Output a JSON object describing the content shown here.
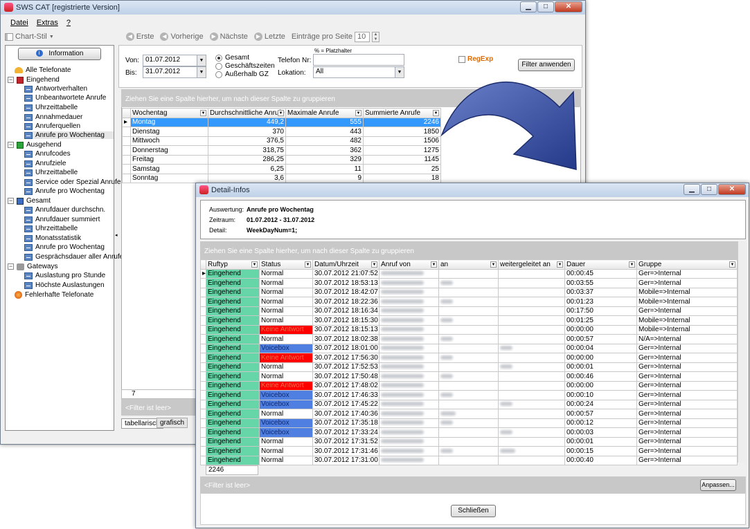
{
  "main_window": {
    "title": "SWS CAT [registrierte Version]",
    "menu": [
      "Datei",
      "Extras",
      "?"
    ],
    "toolbar": {
      "chart_style": "Chart-Stil",
      "first": "Erste",
      "prev": "Vorherige",
      "next": "Nächste",
      "last": "Letzte",
      "per_page_label": "Einträge pro Seite",
      "per_page_value": "10"
    },
    "sidebar": {
      "info_button": "Information",
      "items": [
        {
          "label": "Alle Telefonate"
        },
        {
          "label": "Eingehend"
        },
        {
          "label": "Antwortverhalten"
        },
        {
          "label": "Unbeantwortete Anrufe"
        },
        {
          "label": "Uhrzeittabelle"
        },
        {
          "label": "Annahmedauer"
        },
        {
          "label": "Anruferquellen"
        },
        {
          "label": "Anrufe pro Wochentag"
        },
        {
          "label": "Ausgehend"
        },
        {
          "label": "Anrufcodes"
        },
        {
          "label": "Anrufziele"
        },
        {
          "label": "Uhrzeittabelle"
        },
        {
          "label": "Service oder Spezial Anrufe"
        },
        {
          "label": "Anrufe pro Wochentag"
        },
        {
          "label": "Gesamt"
        },
        {
          "label": "Anrufdauer durchschn."
        },
        {
          "label": "Anrufdauer summiert"
        },
        {
          "label": "Uhrzeittabelle"
        },
        {
          "label": "Monatsstatistik"
        },
        {
          "label": "Anrufe pro Wochentag"
        },
        {
          "label": "Gesprächsdauer aller Anrufe"
        },
        {
          "label": "Gateways"
        },
        {
          "label": "Auslastung pro Stunde"
        },
        {
          "label": "Höchste Auslastungen"
        },
        {
          "label": "Fehlerhafte Telefonate"
        }
      ]
    },
    "filter": {
      "von_label": "Von:",
      "von_value": "01.07.2012",
      "bis_label": "Bis:",
      "bis_value": "31.07.2012",
      "radio_gesamt": "Gesamt",
      "radio_geschaeft": "Geschäftszeiten",
      "radio_ausserhalb": "Außerhalb GZ",
      "placeholder_hint": "% = Platzhalter",
      "telefon_label": "Telefon Nr:",
      "lokation_label": "Lokation:",
      "lokation_value": "All",
      "regexp_label": "RegExp",
      "apply_button": "Filter anwenden"
    },
    "group_hint": "Ziehen Sie eine Spalte hierher, um nach dieser Spalte zu gruppieren",
    "grid": {
      "headers": [
        "Wochentag",
        "Durchschnittliche Anrufe",
        "Maximale Anrufe",
        "Summierte Anrufe"
      ],
      "rows": [
        [
          "Montag",
          "449,2",
          "555",
          "2246"
        ],
        [
          "Dienstag",
          "370",
          "443",
          "1850"
        ],
        [
          "Mittwoch",
          "376,5",
          "482",
          "1506"
        ],
        [
          "Donnerstag",
          "318,75",
          "362",
          "1275"
        ],
        [
          "Freitag",
          "286,25",
          "329",
          "1145"
        ],
        [
          "Samstag",
          "6,25",
          "11",
          "25"
        ],
        [
          "Sonntag",
          "3,6",
          "9",
          "18"
        ]
      ],
      "footer_count": "7",
      "filter_empty": "<Filter ist leer>"
    },
    "tabs": [
      "tabellarisch",
      "grafisch"
    ]
  },
  "detail_window": {
    "title": "Detail-Infos",
    "auswertung_label": "Auswertung:",
    "auswertung_value": "Anrufe pro Wochentag",
    "zeitraum_label": "Zeitraum:",
    "zeitraum_value": "01.07.2012 - 31.07.2012",
    "detail_label": "Detail:",
    "detail_value": "WeekDayNum=1;",
    "group_hint": "Ziehen Sie eine Spalte hierher, um nach dieser Spalte zu gruppieren",
    "headers": [
      "Ruftyp",
      "Status",
      "Datum/Uhrzeit",
      "Anruf von",
      "an",
      "weitergeleitet an",
      "Dauer",
      "Gruppe"
    ],
    "rows": [
      {
        "typ": "Eingehend",
        "status": "Normal",
        "datum": "30.07.2012 21:07:52",
        "dauer": "00:00:45",
        "gruppe": "Ger=>Internal"
      },
      {
        "typ": "Eingehend",
        "status": "Normal",
        "datum": "30.07.2012 18:53:13",
        "dauer": "00:03:55",
        "gruppe": "Ger=>Internal"
      },
      {
        "typ": "Eingehend",
        "status": "Normal",
        "datum": "30.07.2012 18:42:07",
        "dauer": "00:03:37",
        "gruppe": "Mobile=>Internal"
      },
      {
        "typ": "Eingehend",
        "status": "Normal",
        "datum": "30.07.2012 18:22:36",
        "dauer": "00:01:23",
        "gruppe": "Mobile=>Internal"
      },
      {
        "typ": "Eingehend",
        "status": "Normal",
        "datum": "30.07.2012 18:16:34",
        "dauer": "00:17:50",
        "gruppe": "Ger=>Internal"
      },
      {
        "typ": "Eingehend",
        "status": "Normal",
        "datum": "30.07.2012 18:15:30",
        "dauer": "00:01:25",
        "gruppe": "Mobile=>Internal"
      },
      {
        "typ": "Eingehend",
        "status": "Keine Antwort",
        "datum": "30.07.2012 18:15:13",
        "dauer": "00:00:00",
        "gruppe": "Mobile=>Internal"
      },
      {
        "typ": "Eingehend",
        "status": "Normal",
        "datum": "30.07.2012 18:02:38",
        "dauer": "00:00:57",
        "gruppe": "N/A=>Internal"
      },
      {
        "typ": "Eingehend",
        "status": "Voicebox",
        "datum": "30.07.2012 18:01:00",
        "dauer": "00:00:04",
        "gruppe": "Ger=>Internal"
      },
      {
        "typ": "Eingehend",
        "status": "Keine Antwort",
        "datum": "30.07.2012 17:56:30",
        "dauer": "00:00:00",
        "gruppe": "Ger=>Internal"
      },
      {
        "typ": "Eingehend",
        "status": "Normal",
        "datum": "30.07.2012 17:52:53",
        "dauer": "00:00:01",
        "gruppe": "Ger=>Internal"
      },
      {
        "typ": "Eingehend",
        "status": "Normal",
        "datum": "30.07.2012 17:50:48",
        "dauer": "00:00:46",
        "gruppe": "Ger=>Internal"
      },
      {
        "typ": "Eingehend",
        "status": "Keine Antwort",
        "datum": "30.07.2012 17:48:02",
        "dauer": "00:00:00",
        "gruppe": "Ger=>Internal"
      },
      {
        "typ": "Eingehend",
        "status": "Voicebox",
        "datum": "30.07.2012 17:46:33",
        "dauer": "00:00:10",
        "gruppe": "Ger=>Internal"
      },
      {
        "typ": "Eingehend",
        "status": "Voicebox",
        "datum": "30.07.2012 17:45:22",
        "dauer": "00:00:24",
        "gruppe": "Ger=>Internal"
      },
      {
        "typ": "Eingehend",
        "status": "Normal",
        "datum": "30.07.2012 17:40:36",
        "dauer": "00:00:57",
        "gruppe": "Ger=>Internal"
      },
      {
        "typ": "Eingehend",
        "status": "Voicebox",
        "datum": "30.07.2012 17:35:18",
        "dauer": "00:00:12",
        "gruppe": "Ger=>Internal"
      },
      {
        "typ": "Eingehend",
        "status": "Voicebox",
        "datum": "30.07.2012 17:33:24",
        "dauer": "00:00:03",
        "gruppe": "Ger=>Internal"
      },
      {
        "typ": "Eingehend",
        "status": "Normal",
        "datum": "30.07.2012 17:31:52",
        "dauer": "00:00:01",
        "gruppe": "Ger=>Internal"
      },
      {
        "typ": "Eingehend",
        "status": "Normal",
        "datum": "30.07.2012 17:31:46",
        "dauer": "00:00:15",
        "gruppe": "Ger=>Internal"
      },
      {
        "typ": "Eingehend",
        "status": "Normal",
        "datum": "30.07.2012 17:31:00",
        "dauer": "00:00:40",
        "gruppe": "Ger=>Internal"
      }
    ],
    "footer_count": "2246",
    "filter_empty": "<Filter ist leer>",
    "customize_button": "Anpassen...",
    "close_button": "Schließen"
  },
  "colors": {
    "row_ruftyp": "#66d6a8",
    "status_keine": "#ff0000",
    "status_voicebox": "#4f7fe0",
    "selection": "#3399ff",
    "arrow": "#3b4f9c"
  }
}
